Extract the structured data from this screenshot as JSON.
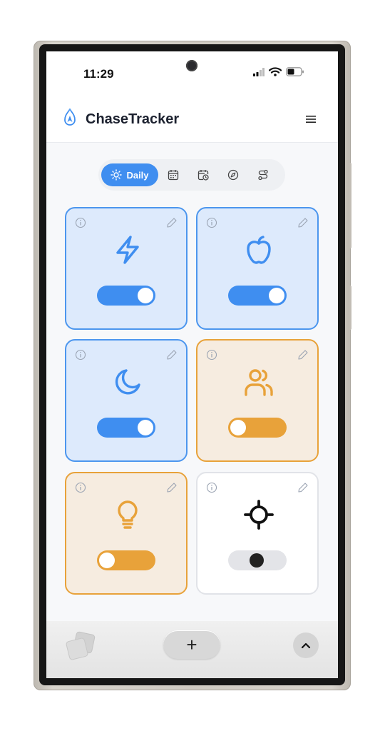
{
  "status_bar": {
    "time": "11:29"
  },
  "header": {
    "title": "ChaseTracker"
  },
  "view_switcher": {
    "active_label": "Daily",
    "tabs": [
      {
        "icon": "sun-icon",
        "label": "Daily",
        "active": true
      },
      {
        "icon": "calendar-icon"
      },
      {
        "icon": "calendar-clock-icon"
      },
      {
        "icon": "compass-icon"
      },
      {
        "icon": "route-icon"
      }
    ]
  },
  "cards": [
    {
      "icon": "lightning-icon",
      "theme": "blue",
      "toggle": "on"
    },
    {
      "icon": "apple-icon",
      "theme": "blue",
      "toggle": "on"
    },
    {
      "icon": "moon-icon",
      "theme": "blue",
      "toggle": "on"
    },
    {
      "icon": "users-icon",
      "theme": "orange",
      "toggle": "off"
    },
    {
      "icon": "lightbulb-icon",
      "theme": "orange",
      "toggle": "off"
    },
    {
      "icon": "crosshair-icon",
      "theme": "white",
      "toggle": "neutral"
    }
  ],
  "bottom_bar": {
    "add_label": "+"
  },
  "colors": {
    "accent_blue": "#3f8ef0",
    "card_blue_bg": "#ddeafc",
    "accent_orange": "#e8a23a",
    "card_orange_bg": "#f6ece0",
    "text_dark": "#1d2230"
  }
}
